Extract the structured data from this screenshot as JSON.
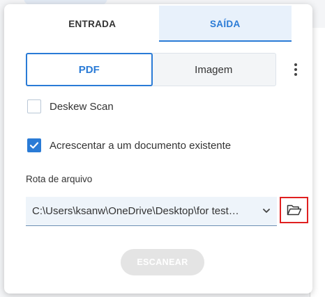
{
  "tabs": [
    {
      "label": "ENTRADA",
      "active": false
    },
    {
      "label": "SAÍDA",
      "active": true
    }
  ],
  "format": {
    "options": [
      "PDF",
      "Imagem"
    ],
    "selected": "PDF"
  },
  "options": {
    "deskew": {
      "label": "Deskew Scan",
      "checked": false
    },
    "append": {
      "label": "Acrescentar a um documento existente",
      "checked": true
    }
  },
  "path": {
    "label": "Rota de arquivo",
    "value": "C:\\Users\\ksanw\\OneDrive\\Desktop\\for test…"
  },
  "actions": {
    "scan_label": "ESCANEAR"
  },
  "colors": {
    "accent": "#2a7bd6",
    "highlight_border": "#e02020",
    "disabled_button": "#e4e4e4"
  },
  "icons": {
    "more": "kebab-menu-icon",
    "chevron": "chevron-down-icon",
    "folder": "folder-open-icon",
    "check": "checkmark-icon"
  }
}
